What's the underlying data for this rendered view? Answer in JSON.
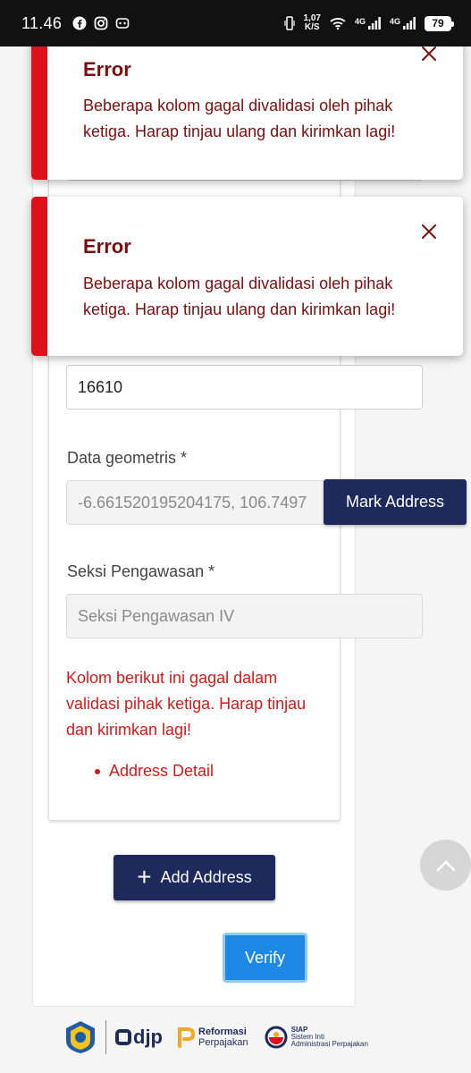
{
  "status_bar": {
    "time": "11.46",
    "speed_value": "1,07",
    "speed_unit": "K/S",
    "network_1": "4G",
    "network_2": "4G",
    "battery": "79"
  },
  "toasts": [
    {
      "title": "Error",
      "message": "Beberapa kolom gagal divalidasi oleh pihak ketiga. Harap tinjau ulang dan kirimkan lagi!"
    },
    {
      "title": "Error",
      "message": "Beberapa kolom gagal divalidasi oleh pihak ketiga. Harap tinjau ulang dan kirimkan lagi!"
    }
  ],
  "form": {
    "postal_code_value": "16610",
    "geometry_label": "Data geometris *",
    "geometry_value": "-6.661520195204175, 106.7497",
    "mark_address_label": "Mark Address",
    "seksi_label": "Seksi Pengawasan *",
    "seksi_value": "Seksi Pengawasan IV",
    "validation_error": "Kolom berikut ini gagal dalam validasi pihak ketiga. Harap tinjau dan kirimkan lagi!",
    "failed_fields": [
      "Address Detail"
    ]
  },
  "actions": {
    "add_address_label": "Add Address",
    "verify_label": "Verify"
  },
  "footer": {
    "djp": "djp",
    "reformasi_line1": "Reformasi",
    "reformasi_line2": "Perpajakan",
    "siap_title": "SIAP",
    "siap_sub1": "Sistem Inti",
    "siap_sub2": "Administrasi Perpajakan"
  },
  "colors": {
    "primary_navy": "#1f2a5c",
    "verify_blue": "#1e88e5",
    "error_red": "#d11a1a",
    "toast_accent": "#e0101b"
  }
}
